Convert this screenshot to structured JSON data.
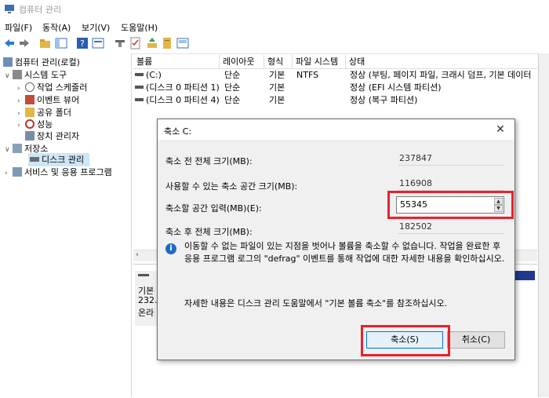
{
  "window": {
    "title": "컴퓨터 관리"
  },
  "menu": [
    "파일(F)",
    "동작(A)",
    "보기(V)",
    "도움말(H)"
  ],
  "tree": {
    "root": "컴퓨터 관리(로컬)",
    "system_tools": "시스템 도구",
    "task_scheduler": "작업 스케줄러",
    "event_viewer": "이벤트 뷰어",
    "shared_folders": "공유 폴더",
    "performance": "성능",
    "device_manager": "장치 관리자",
    "storage": "저장소",
    "disk_management": "디스크 관리",
    "services_apps": "서비스 및 응용 프로그램"
  },
  "volume_list": {
    "headers": [
      "볼륨",
      "레이아웃",
      "형식",
      "파일 시스템",
      "상태"
    ],
    "rows": [
      [
        "(C:)",
        "단순",
        "기본",
        "NTFS",
        "정상 (부팅, 페이지 파일, 크래시 덤프, 기본 데이터"
      ],
      [
        "(디스크 0 파티션 1)",
        "단순",
        "기본",
        "",
        "정상 (EFI 시스템 파티션)"
      ],
      [
        "(디스크 0 파티션 4)",
        "단순",
        "기본",
        "",
        "정상 (복구 파티션)"
      ]
    ]
  },
  "lower_pane": {
    "line1": "기본",
    "line2": "232.",
    "line3": "온라"
  },
  "dialog": {
    "title": "축소 C:",
    "close": "✕",
    "fields": [
      {
        "label": "축소 전 전체 크기(MB):",
        "value": "237847"
      },
      {
        "label": "사용할 수 있는 축소 공간 크기(MB):",
        "value": "116908"
      },
      {
        "label": "축소할 공간 입력(MB)(E):",
        "value": "55345"
      },
      {
        "label": "축소 후 전체 크기(MB):",
        "value": "182502"
      }
    ],
    "info_icon": "i",
    "info_text": "이동할 수 없는 파일이 있는 지점을 벗어나 볼륨을 축소할 수 없습니다. 작업을 완료한 후 응용 프로그램 로그의 \"defrag\" 이벤트를 통해 작업에 대한 자세한 내용을 확인하십시오.",
    "reference_text": "자세한 내용은 디스크 관리 도움말에서 \"기본 볼륨 축소\"를 참조하십시오.",
    "shrink_button": "축소(S)",
    "cancel_button": "취소(C)"
  },
  "colors": {
    "highlight": "#e8222b",
    "selection": "#cde6f7",
    "accent": "#0078d7"
  }
}
